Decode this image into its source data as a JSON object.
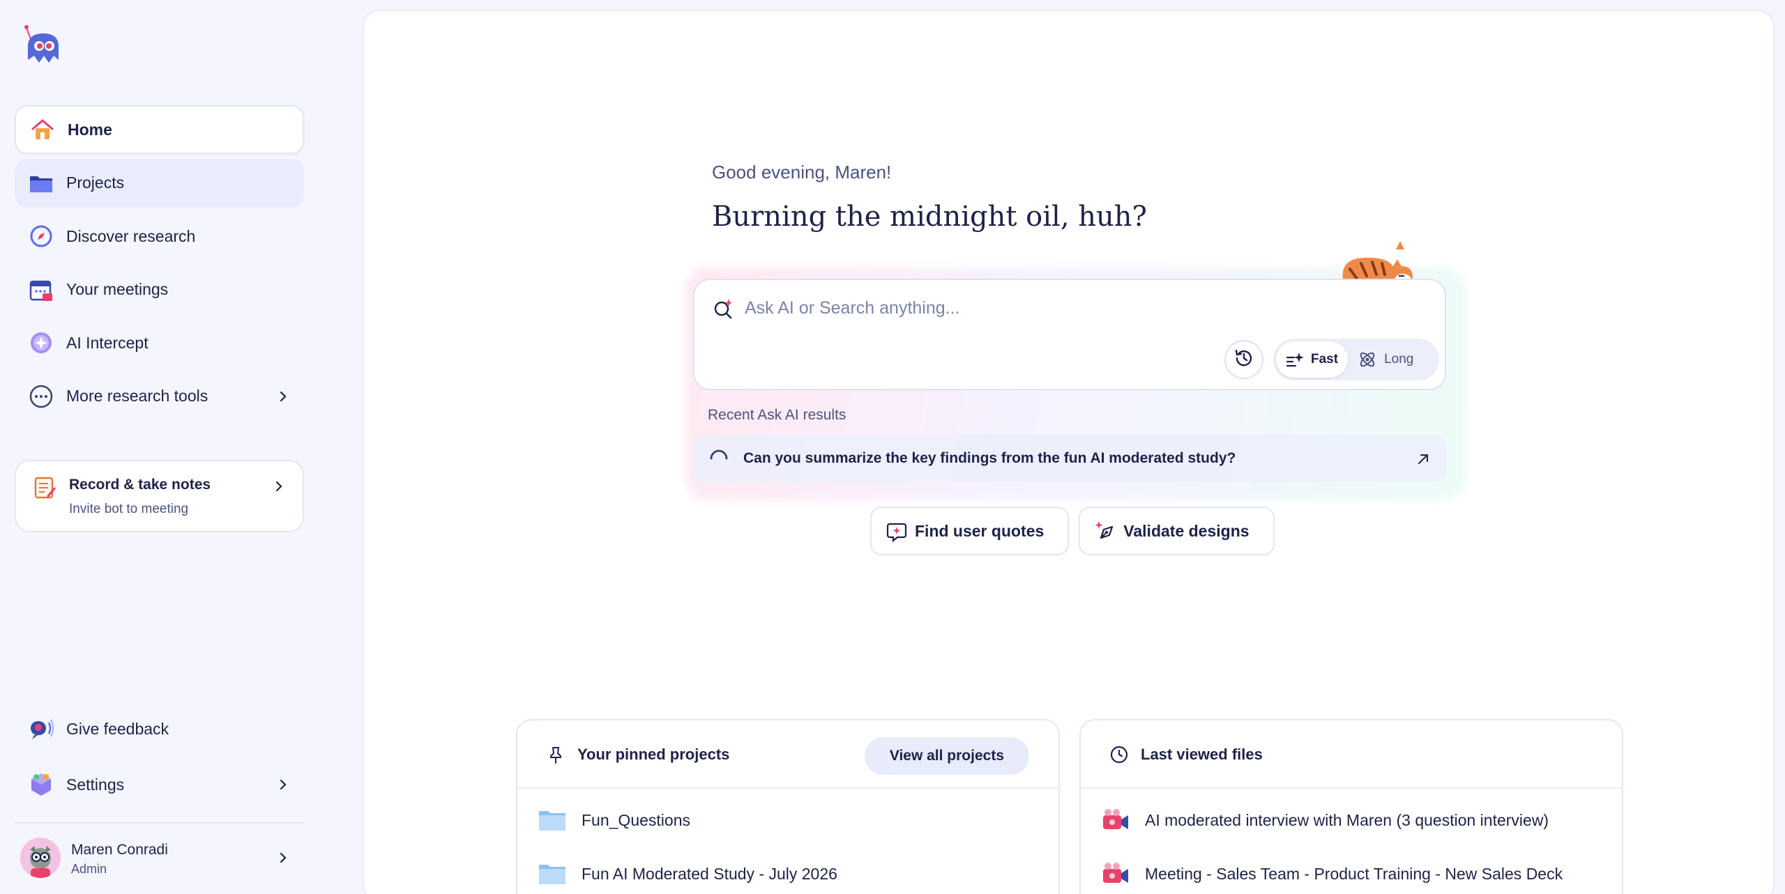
{
  "nav": {
    "items": [
      {
        "label": "Home",
        "icon": "home-icon"
      },
      {
        "label": "Projects",
        "icon": "folder-icon"
      },
      {
        "label": "Discover research",
        "icon": "compass-icon"
      },
      {
        "label": "Your meetings",
        "icon": "calendar-icon"
      },
      {
        "label": "AI Intercept",
        "icon": "sparkle-icon"
      },
      {
        "label": "More research tools",
        "icon": "ellipsis-icon"
      }
    ]
  },
  "record": {
    "title": "Record & take notes",
    "subtitle": "Invite bot to meeting"
  },
  "bottom_nav": {
    "feedback": "Give feedback",
    "settings": "Settings"
  },
  "user": {
    "name": "Maren Conradi",
    "role": "Admin"
  },
  "main": {
    "greeting": "Good evening, Maren!",
    "headline": "Burning the midnight oil, huh?",
    "search": {
      "placeholder": "Ask AI or Search anything..."
    },
    "modes": {
      "fast": "Fast",
      "long": "Long"
    },
    "recent_label": "Recent Ask AI results",
    "recent_item": "Can you summarize the key findings from the fun AI moderated study?",
    "suggestions": {
      "quotes": "Find user quotes",
      "validate": "Validate designs"
    }
  },
  "pinned": {
    "title": "Your pinned projects",
    "view_all": "View all projects",
    "items": [
      "Fun_Questions",
      "Fun AI Moderated Study - July 2026"
    ]
  },
  "last_viewed": {
    "title": "Last viewed files",
    "items": [
      "AI moderated interview with Maren (3 question interview)",
      "Meeting - Sales Team - Product Training - New Sales Deck"
    ]
  },
  "colors": {
    "accent": "#5b6cf0",
    "text": "#1e2247",
    "muted": "#4b527f",
    "sidebar_bg": "#f4f5fd"
  }
}
